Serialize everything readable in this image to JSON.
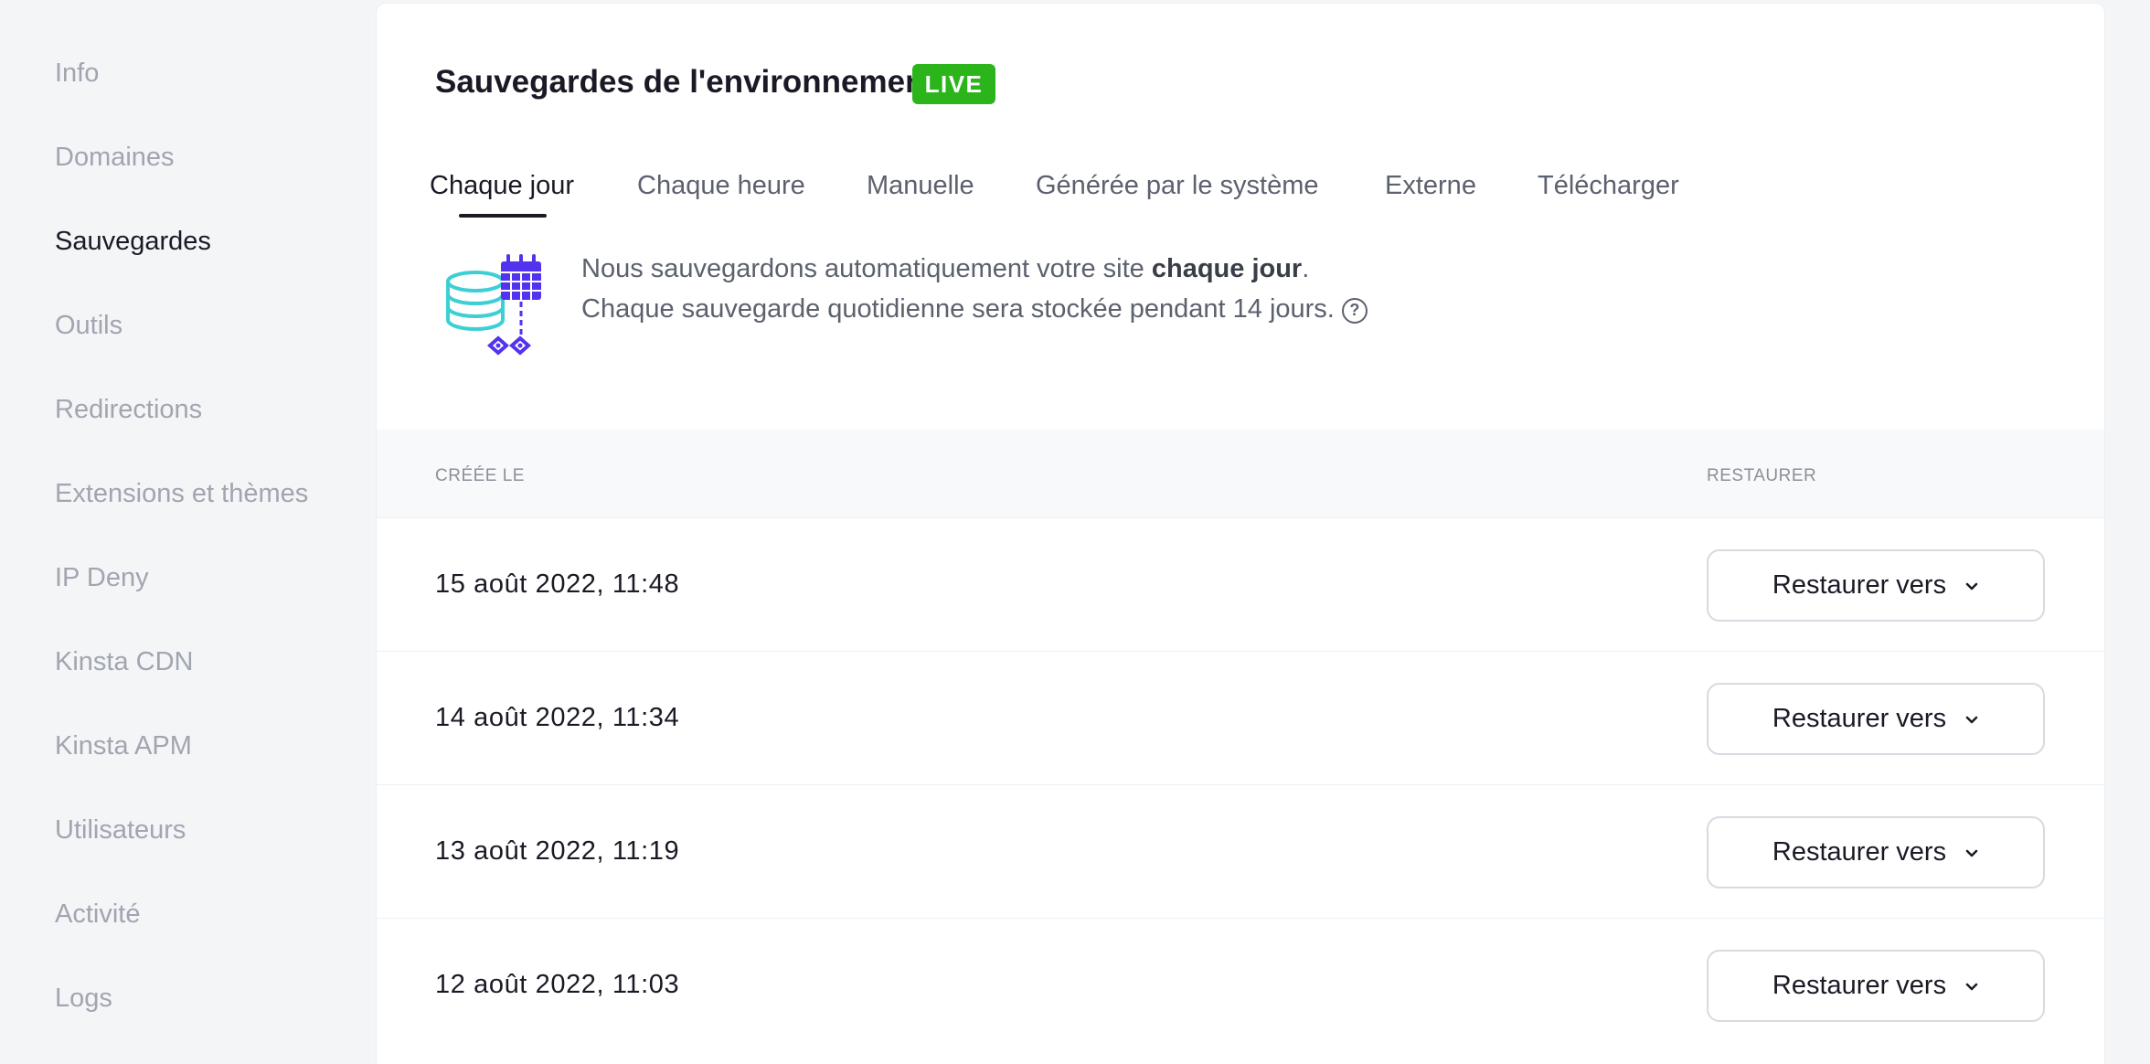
{
  "sidebar": {
    "items": [
      {
        "label": "Info",
        "active": false
      },
      {
        "label": "Domaines",
        "active": false
      },
      {
        "label": "Sauvegardes",
        "active": true
      },
      {
        "label": "Outils",
        "active": false
      },
      {
        "label": "Redirections",
        "active": false
      },
      {
        "label": "Extensions et thèmes",
        "active": false
      },
      {
        "label": "IP Deny",
        "active": false
      },
      {
        "label": "Kinsta CDN",
        "active": false
      },
      {
        "label": "Kinsta APM",
        "active": false
      },
      {
        "label": "Utilisateurs",
        "active": false
      },
      {
        "label": "Activité",
        "active": false
      },
      {
        "label": "Logs",
        "active": false
      }
    ]
  },
  "header": {
    "title": "Sauvegardes de l'environnement",
    "badge": "LIVE"
  },
  "tabs": [
    {
      "label": "Chaque jour",
      "active": true
    },
    {
      "label": "Chaque heure",
      "active": false
    },
    {
      "label": "Manuelle",
      "active": false
    },
    {
      "label": "Générée par le système",
      "active": false
    },
    {
      "label": "Externe",
      "active": false
    },
    {
      "label": "Télécharger",
      "active": false
    }
  ],
  "info": {
    "line1_prefix": "Nous sauvegardons automatiquement votre site ",
    "line1_bold": "chaque jour",
    "line1_suffix": ".",
    "line2": "Chaque sauvegarde quotidienne sera stockée pendant 14 jours.",
    "help_icon": "question-circle-icon",
    "illustration_icon": "database-calendar-icon"
  },
  "table": {
    "col_created": "CRÉÉE LE",
    "col_restore": "RESTAURER",
    "restore_label": "Restaurer vers",
    "rows": [
      {
        "date": "15 août 2022, 11:48"
      },
      {
        "date": "14 août 2022, 11:34"
      },
      {
        "date": "13 août 2022, 11:19"
      },
      {
        "date": "12 août 2022, 11:03"
      }
    ]
  },
  "colors": {
    "live_badge": "#2bb51b",
    "illustration_purple": "#5333ed",
    "illustration_teal": "#3ecfd4"
  }
}
